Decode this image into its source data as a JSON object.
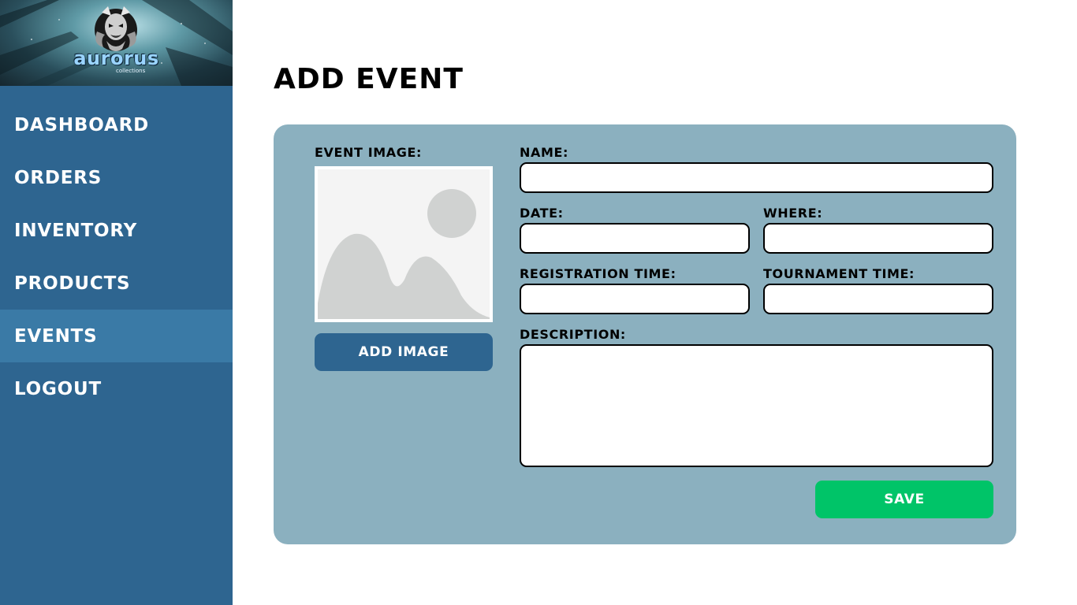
{
  "brand": {
    "name": "aurorus",
    "tagline": "collections"
  },
  "sidebar": {
    "items": [
      {
        "label": "DASHBOARD",
        "active": false
      },
      {
        "label": "ORDERS",
        "active": false
      },
      {
        "label": "INVENTORY",
        "active": false
      },
      {
        "label": "PRODUCTS",
        "active": false
      },
      {
        "label": "EVENTS",
        "active": true
      },
      {
        "label": "LOGOUT",
        "active": false
      }
    ]
  },
  "page": {
    "title": "ADD EVENT"
  },
  "form": {
    "event_image_label": "EVENT IMAGE:",
    "add_image_label": "ADD IMAGE",
    "name_label": "NAME:",
    "name_value": "",
    "date_label": "DATE:",
    "date_value": "",
    "where_label": "WHERE:",
    "where_value": "",
    "registration_time_label": "REGISTRATION TIME:",
    "registration_time_value": "",
    "tournament_time_label": "TOURNAMENT TIME:",
    "tournament_time_value": "",
    "description_label": "DESCRIPTION:",
    "description_value": "",
    "save_label": "SAVE"
  },
  "icons": {
    "logo": "dragon-logo-icon",
    "image_placeholder": "image-placeholder-icon"
  },
  "colors": {
    "sidebar": "#2e6590",
    "sidebar_active": "#3a7aa6",
    "card": "#8bb0bf",
    "add_image_button": "#2e6590",
    "save_button": "#00c468"
  }
}
